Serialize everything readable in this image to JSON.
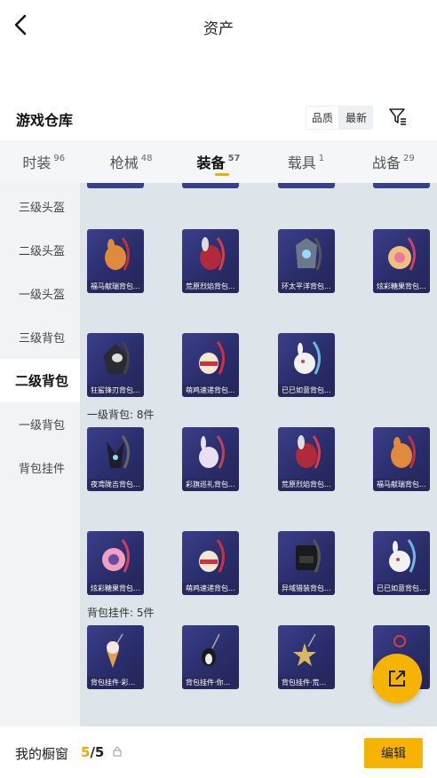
{
  "header": {
    "title": "资产"
  },
  "warehouse": {
    "title": "游戏仓库",
    "sort": [
      "品质",
      "最新"
    ]
  },
  "tabs": [
    {
      "label": "时装",
      "count": "96"
    },
    {
      "label": "枪械",
      "count": "48"
    },
    {
      "label": "装备",
      "count": "57"
    },
    {
      "label": "载具",
      "count": "1"
    },
    {
      "label": "战备",
      "count": "29"
    }
  ],
  "sidebar": [
    "三级头盔",
    "二级头盔",
    "一级头盔",
    "三级背包",
    "二级背包",
    "一级背包",
    "背包挂件"
  ],
  "groups": {
    "lv2_row1": [
      "福马献瑞背包...",
      "荒原烈焰背包...",
      "环太平洋背包...",
      "炫彩糖果背包..."
    ],
    "lv2_row2": [
      "狂鲨锋刃背包...",
      "萌鸡速递背包...",
      "已已如意背包..."
    ],
    "lv1_title": "一级背包: 8件",
    "lv1_row1": [
      "夜鸢陇吉背包...",
      "彩旗巡礼背包...",
      "荒原烈焰背包...",
      "福马献瑞背包..."
    ],
    "lv1_row2": [
      "炫彩糖果背包...",
      "萌鸡速递背包...",
      "异域猎装背包...",
      "已已如意背包..."
    ],
    "charm_title": "背包挂件: 5件",
    "charm_row1": [
      "背包挂件·彩...",
      "背包挂件·你...",
      "背包挂件·荒..."
    ]
  },
  "bottom": {
    "label": "我的橱窗",
    "current": "5",
    "total": "/5",
    "edit": "编辑"
  },
  "colors": {
    "accent": "#f5a800",
    "card": "#2e3270"
  }
}
